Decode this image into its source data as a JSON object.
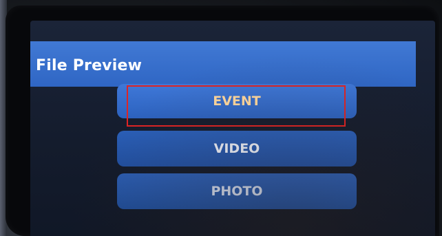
{
  "screen": {
    "title": "File Preview"
  },
  "menu": {
    "items": [
      {
        "label": "EVENT",
        "selected": true
      },
      {
        "label": "VIDEO",
        "selected": false
      },
      {
        "label": "PHOTO",
        "selected": false
      }
    ]
  },
  "colors": {
    "title_bar": "#3a72cf",
    "selected_text": "#ffd9a0",
    "button": "#2c62bf",
    "highlight_box": "#e02424"
  }
}
